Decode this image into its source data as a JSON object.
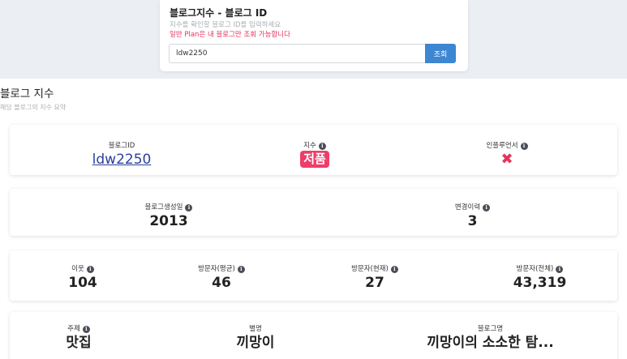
{
  "search": {
    "title": "블로그지수 - 블로그 ID",
    "hint": "지수를 확인할 블로그 ID를 입력하세요",
    "warning": "일반 Plan은 내 블로그만 조회 가능합니다",
    "input_value": "ldw2250",
    "button_label": "조회"
  },
  "section": {
    "title": "블로그 지수",
    "subtitle": "해당 블로그의 지수 요약"
  },
  "card1": {
    "blog_id_label": "블로그ID",
    "blog_id_value": "ldw2250",
    "index_label": "지수",
    "index_value": "저품",
    "influencer_label": "인플루언서",
    "influencer_value": "✖"
  },
  "card2": {
    "created_label": "블로그생성일",
    "created_value": "2013",
    "history_label": "변경이력",
    "history_value": "3"
  },
  "card3": {
    "neighbors_label": "이웃",
    "neighbors_value": "104",
    "visitors_avg_label": "방문자(평균)",
    "visitors_avg_value": "46",
    "visitors_now_label": "방문자(현재)",
    "visitors_now_value": "27",
    "visitors_total_label": "방문자(전체)",
    "visitors_total_value": "43,319"
  },
  "card4": {
    "topic_label": "주제",
    "topic_value": "맛집",
    "nickname_label": "별명",
    "nickname_value": "끼망이",
    "blogname_label": "블로그명",
    "blogname_value": "끼망이의 소소한 탐..."
  },
  "colors": {
    "accent": "#3d86d2",
    "warning": "#e5315a",
    "badge": "#ef3d6b",
    "link": "#2b3fa0"
  }
}
